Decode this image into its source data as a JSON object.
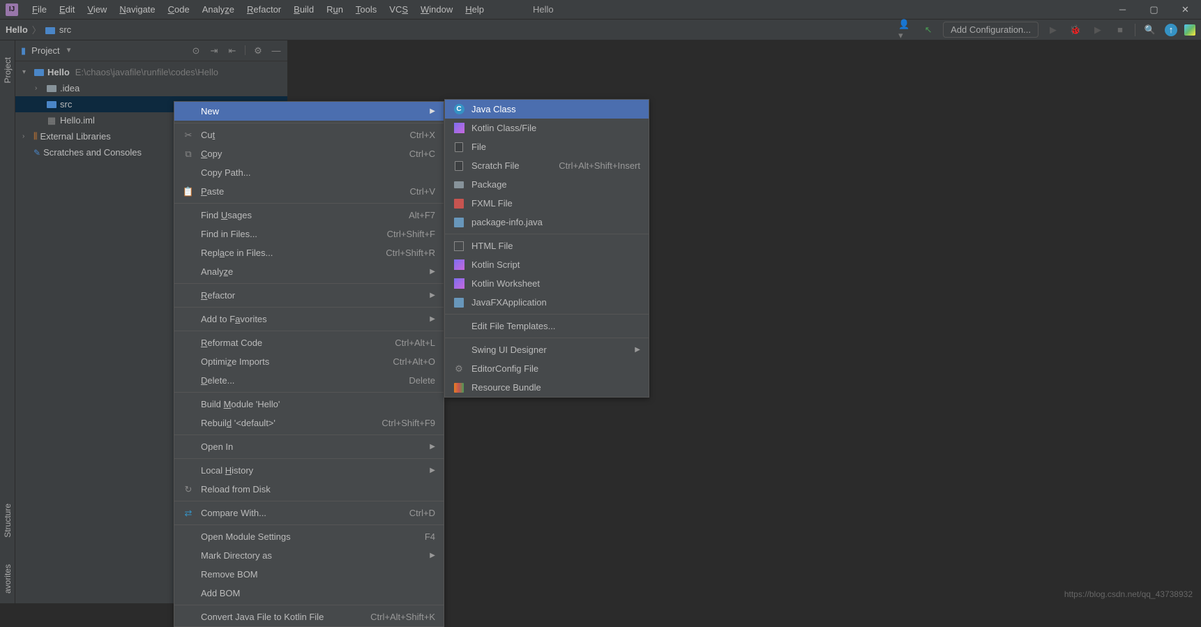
{
  "window_title": "Hello",
  "menus": [
    "File",
    "Edit",
    "View",
    "Navigate",
    "Code",
    "Analyze",
    "Refactor",
    "Build",
    "Run",
    "Tools",
    "VCS",
    "Window",
    "Help"
  ],
  "breadcrumb": {
    "root": "Hello",
    "child": "src"
  },
  "config_placeholder": "Add Configuration...",
  "project_label": "Project",
  "tree": {
    "root_name": "Hello",
    "root_path": "E:\\chaos\\javafile\\runfile\\codes\\Hello",
    "idea": ".idea",
    "src": "src",
    "iml": "Hello.iml",
    "ext": "External Libraries",
    "scratch": "Scratches and Consoles"
  },
  "ctx": {
    "new": "New",
    "cut": "Cut",
    "cut_sc": "Ctrl+X",
    "copy": "Copy",
    "copy_sc": "Ctrl+C",
    "copypath": "Copy Path...",
    "paste": "Paste",
    "paste_sc": "Ctrl+V",
    "findusages": "Find Usages",
    "findusages_sc": "Alt+F7",
    "findinfiles": "Find in Files...",
    "findinfiles_sc": "Ctrl+Shift+F",
    "replaceinfiles": "Replace in Files...",
    "replaceinfiles_sc": "Ctrl+Shift+R",
    "analyze": "Analyze",
    "refactor": "Refactor",
    "addfav": "Add to Favorites",
    "reformat": "Reformat Code",
    "reformat_sc": "Ctrl+Alt+L",
    "optimize": "Optimize Imports",
    "optimize_sc": "Ctrl+Alt+O",
    "delete": "Delete...",
    "delete_sc": "Delete",
    "buildmod": "Build Module 'Hello'",
    "rebuild": "Rebuild '<default>'",
    "rebuild_sc": "Ctrl+Shift+F9",
    "openin": "Open In",
    "localhist": "Local History",
    "reload": "Reload from Disk",
    "compare": "Compare With...",
    "compare_sc": "Ctrl+D",
    "modset": "Open Module Settings",
    "modset_sc": "F4",
    "markdir": "Mark Directory as",
    "removebom": "Remove BOM",
    "addbom": "Add BOM",
    "convert": "Convert Java File to Kotlin File",
    "convert_sc": "Ctrl+Alt+Shift+K"
  },
  "sub": {
    "javaclass": "Java Class",
    "kotlinclass": "Kotlin Class/File",
    "file": "File",
    "scratch": "Scratch File",
    "scratch_sc": "Ctrl+Alt+Shift+Insert",
    "package": "Package",
    "fxml": "FXML File",
    "pkginfo": "package-info.java",
    "html": "HTML File",
    "kscript": "Kotlin Script",
    "kworksheet": "Kotlin Worksheet",
    "javafx": "JavaFXApplication",
    "tpl": "Edit File Templates...",
    "swing": "Swing UI Designer",
    "editorconfig": "EditorConfig File",
    "resbundle": "Resource Bundle"
  },
  "sidebar": {
    "project": "Project",
    "structure": "Structure",
    "favorites": "avorites"
  },
  "watermark": "https://blog.csdn.net/qq_43738932"
}
